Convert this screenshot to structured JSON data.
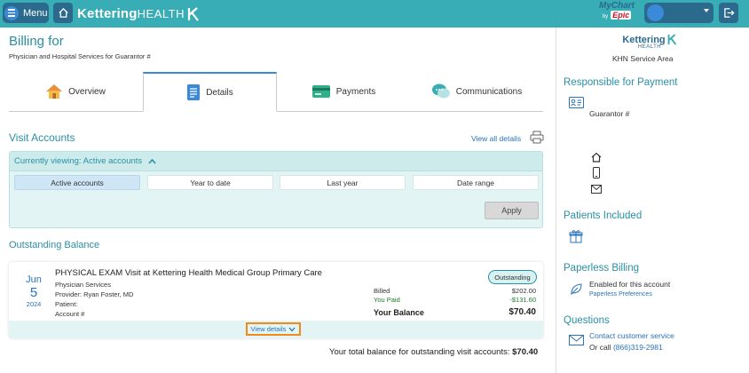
{
  "topbar": {
    "menu_label": "Menu",
    "logo_kettering": "Kettering",
    "logo_health": "HEALTH",
    "mychart": "MyChart",
    "mychart_by": "by",
    "epic": "Epic"
  },
  "header": {
    "title": "Billing for",
    "subtitle": "Physician and Hospital Services for Guarantor #"
  },
  "tabs": [
    {
      "label": "Overview",
      "icon": "house-icon"
    },
    {
      "label": "Details",
      "icon": "document-icon"
    },
    {
      "label": "Payments",
      "icon": "credit-card-icon"
    },
    {
      "label": "Communications",
      "icon": "chat-bubbles-icon"
    }
  ],
  "visit_accounts": {
    "title": "Visit Accounts",
    "view_all": "View all details",
    "filter_heading": "Currently viewing: Active accounts",
    "filters": [
      "Active accounts",
      "Year to date",
      "Last year",
      "Date range"
    ],
    "apply": "Apply"
  },
  "outstanding": {
    "title": "Outstanding Balance",
    "visit": {
      "month": "Jun",
      "day": "5",
      "year": "2024",
      "title": "PHYSICAL EXAM Visit at Kettering Health Medical Group Primary Care",
      "service": "Physician Services",
      "provider": "Provider: Ryan Foster, MD",
      "patient": "Patient:",
      "account": "Account #",
      "status": "Outstanding",
      "billed_label": "Billed",
      "billed_value": "$202.00",
      "paid_label": "You Paid",
      "paid_value": "-$131.60",
      "balance_label": "Your Balance",
      "balance_value": "$70.40",
      "view_details": "View details"
    },
    "total_text": "Your total balance for outstanding visit accounts:",
    "total_value": "$70.40"
  },
  "sidebar": {
    "logo_kettering": "Kettering",
    "logo_health": "HEALTH",
    "area": "KHN Service Area",
    "responsible_title": "Responsible for Payment",
    "guarantor": "Guarantor #",
    "patients_title": "Patients Included",
    "paperless_title": "Paperless Billing",
    "paperless_status": "Enabled for this account",
    "paperless_link": "Paperless Preferences",
    "questions_title": "Questions",
    "contact_link": "Contact customer service",
    "or_call": "Or call",
    "phone": "(866)319-2981"
  },
  "colors": {
    "topbar": "#39adb5",
    "dark_button": "#2b6a8c",
    "heading": "#2a8fa5",
    "link": "#2a73b9",
    "highlight": "#f08a1c"
  }
}
